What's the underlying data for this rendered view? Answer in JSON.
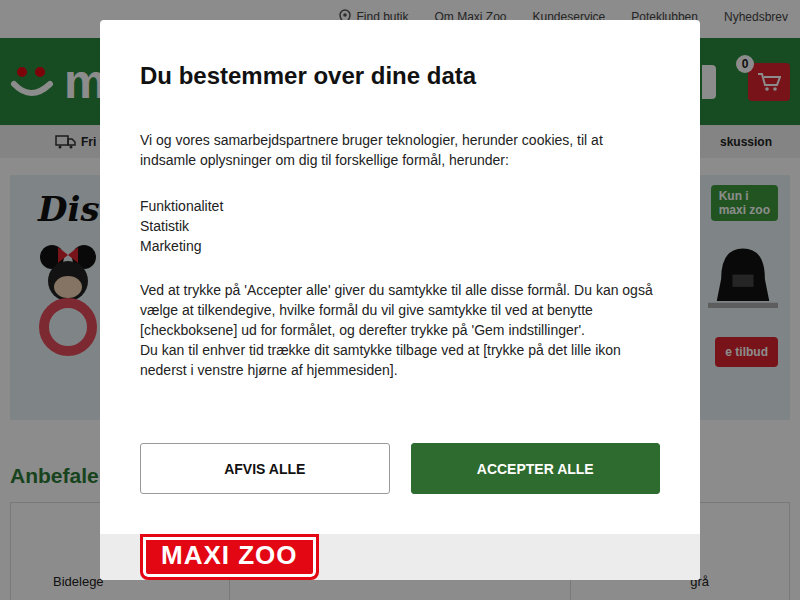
{
  "topbar": {
    "links": [
      "Find butik",
      "Om Maxi Zoo",
      "Kundeservice",
      "Poteklubben",
      "Nyhedsbrev"
    ]
  },
  "header": {
    "logo_text": "m",
    "cart_count": "0"
  },
  "navbar": {
    "left": "Fri f",
    "right": "skussion"
  },
  "banner": {
    "left_logo": "Dis",
    "badge": [
      "Kun i",
      "maxi zoo"
    ],
    "button": "e tilbud"
  },
  "section_title": "Anbefale",
  "products": [
    "Bidelege",
    "grå"
  ],
  "modal": {
    "title": "Du bestemmer over dine data",
    "intro": "Vi og vores samarbejdspartnere bruger teknologier, herunder cookies, til at indsamle oplysninger om dig til forskellige formål, herunder:",
    "purposes": [
      "Funktionalitet",
      "Statistik",
      "Marketing"
    ],
    "details": [
      "Ved at trykke på 'Accepter alle' giver du samtykke til alle disse formål. Du kan også vælge at tilkendegive, hvilke formål du vil give samtykke til ved at benytte [checkboksene] ud for formålet, og derefter trykke på 'Gem indstillinger'.",
      "Du kan til enhver tid trække dit samtykke tilbage ved at [trykke på det lille ikon nederst i venstre hjørne af hjemmesiden]."
    ],
    "buttons": [
      {
        "label": "AFVIS ALLE",
        "kind": "secondary"
      },
      {
        "label": "ACCEPTER ALLE",
        "kind": "primary"
      }
    ],
    "logo": "MAXI ZOO"
  }
}
